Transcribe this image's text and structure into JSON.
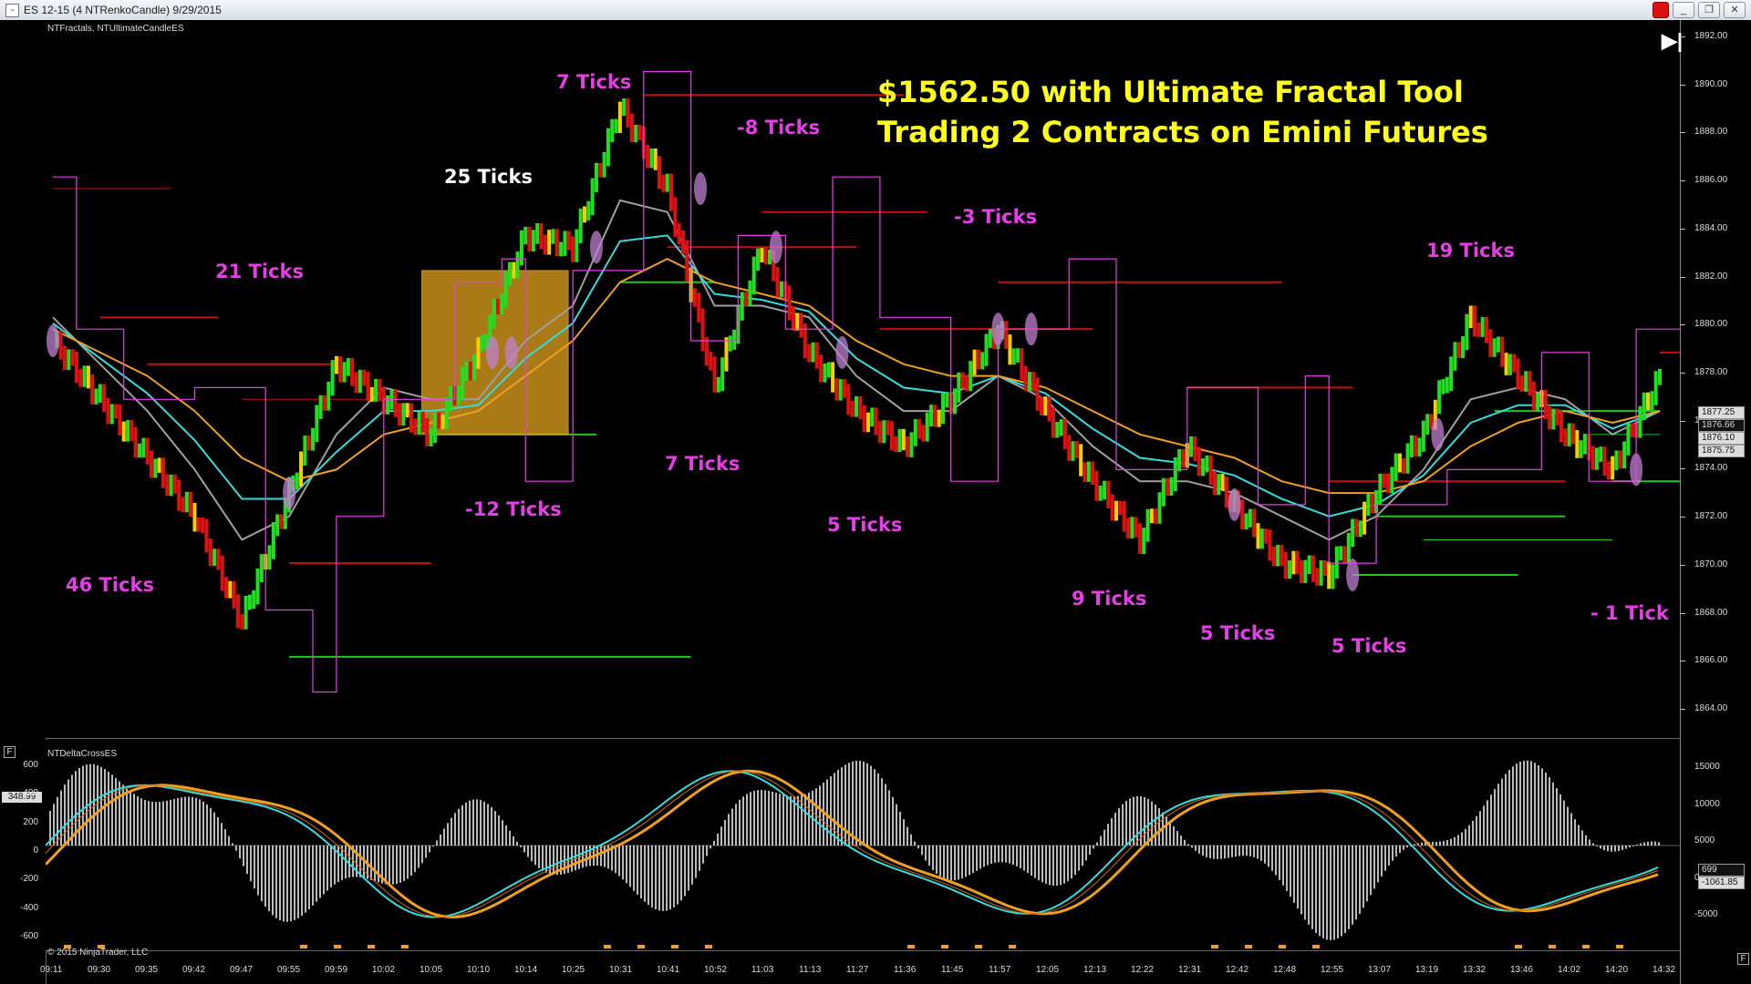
{
  "window": {
    "title": "ES 12-15 (4 NTRenkoCandle)  9/29/2015",
    "min_label": "_",
    "restore_label": "❐",
    "close_label": "✕"
  },
  "price_panel": {
    "indicators_label": "NTFractals, NTUltimateCandleES",
    "y_ticks": [
      "1892.00",
      "1890.00",
      "1888.00",
      "1886.00",
      "1884.00",
      "1882.00",
      "1880.00",
      "1878.00",
      "1876.00",
      "1874.00",
      "1872.00",
      "1870.00",
      "1868.00",
      "1866.00",
      "1864.00"
    ],
    "price_tags": [
      "1877.25",
      "1876.66",
      "1876.10",
      "1875.75"
    ]
  },
  "headline": {
    "line1": "$1562.50 with Ultimate Fractal Tool",
    "line2": "Trading 2 Contracts on Emini Futures"
  },
  "annotations": [
    {
      "text": "7 Ticks",
      "color": "magenta"
    },
    {
      "text": "-8 Ticks",
      "color": "magenta"
    },
    {
      "text": "25 Ticks",
      "color": "white"
    },
    {
      "text": "-3 Ticks",
      "color": "magenta"
    },
    {
      "text": "21 Ticks",
      "color": "magenta"
    },
    {
      "text": "19 Ticks",
      "color": "magenta"
    },
    {
      "text": "7 Ticks",
      "color": "magenta"
    },
    {
      "text": "-12 Ticks",
      "color": "magenta"
    },
    {
      "text": "5 Ticks",
      "color": "magenta"
    },
    {
      "text": "46 Ticks",
      "color": "magenta"
    },
    {
      "text": "9 Ticks",
      "color": "magenta"
    },
    {
      "text": "5 Ticks",
      "color": "magenta"
    },
    {
      "text": "5 Ticks",
      "color": "magenta"
    },
    {
      "text": "- 1 Tick",
      "color": "magenta"
    }
  ],
  "indicator_panel": {
    "label": "NTDeltaCrossES",
    "left_ticks": [
      "600",
      "400",
      "200",
      "0",
      "-200",
      "-400",
      "-600"
    ],
    "right_ticks": [
      "15000",
      "10000",
      "5000",
      "0",
      "-5000"
    ],
    "left_value": "348.99",
    "right_tags": [
      "699",
      "-1061.85"
    ],
    "f_label": "F"
  },
  "x_ticks": [
    "09:11",
    "09:30",
    "09:35",
    "09:42",
    "09:47",
    "09:55",
    "09:59",
    "10:02",
    "10:05",
    "10:10",
    "10:14",
    "10:25",
    "10:31",
    "10:41",
    "10:52",
    "11:03",
    "11:13",
    "11:27",
    "11:36",
    "11:45",
    "11:57",
    "12:05",
    "12:13",
    "12:22",
    "12:31",
    "12:42",
    "12:48",
    "12:55",
    "13:07",
    "13:19",
    "13:32",
    "13:46",
    "14:02",
    "14:20",
    "14:32"
  ],
  "copyright": "© 2015 NinjaTrader, LLC",
  "colors": {
    "up": "#22dd22",
    "down": "#dd1111",
    "neutral": "#f5d000",
    "magenta": "#e63ee6",
    "cyan": "#33dddd",
    "orange": "#f0a020",
    "gray_ma": "#a0a0a0"
  },
  "chart_data": {
    "type": "line",
    "title": "",
    "x": [
      "09:11",
      "09:30",
      "09:35",
      "09:42",
      "09:47",
      "09:55",
      "09:59",
      "10:02",
      "10:05",
      "10:10",
      "10:14",
      "10:25",
      "10:31",
      "10:41",
      "10:52",
      "11:03",
      "11:13",
      "11:27",
      "11:36",
      "11:45",
      "11:57",
      "12:05",
      "12:13",
      "12:22",
      "12:31",
      "12:42",
      "12:48",
      "12:55",
      "13:07",
      "13:19",
      "13:32",
      "13:46",
      "14:02",
      "14:20",
      "14:32"
    ],
    "series": [
      {
        "values": [
          1879.5,
          1877.0,
          1874.5,
          1872.0,
          1867.5,
          1873.0,
          1878.5,
          1877.0,
          1875.5,
          1879.0,
          1884.0,
          1883.5,
          1889.5,
          1886.0,
          1877.5,
          1883.5,
          1879.0,
          1876.5,
          1875.0,
          1877.0,
          1880.0,
          1876.5,
          1873.5,
          1871.0,
          1875.0,
          1872.5,
          1870.0,
          1869.5,
          1873.0,
          1875.5,
          1880.5,
          1878.0,
          1875.5,
          1874.0,
          1878.0
        ]
      },
      {
        "values": [
          1880.5,
          1878.5,
          1876.5,
          1874.0,
          1871.0,
          1872.0,
          1875.5,
          1877.5,
          1877.0,
          1877.0,
          1879.5,
          1881.0,
          1885.5,
          1885.0,
          1881.0,
          1881.0,
          1880.5,
          1878.0,
          1876.5,
          1876.5,
          1878.0,
          1877.0,
          1875.0,
          1873.5,
          1873.5,
          1873.0,
          1872.0,
          1871.0,
          1872.0,
          1874.0,
          1877.0,
          1877.5,
          1877.0,
          1875.5,
          1876.5
        ]
      },
      {
        "values": [
          1880.0,
          1879.0,
          1878.0,
          1876.5,
          1874.5,
          1873.5,
          1874.0,
          1875.5,
          1876.0,
          1876.5,
          1878.0,
          1879.5,
          1882.0,
          1883.0,
          1882.0,
          1881.5,
          1881.0,
          1879.5,
          1878.5,
          1878.0,
          1878.0,
          1877.5,
          1876.5,
          1875.5,
          1875.0,
          1874.5,
          1873.5,
          1873.0,
          1873.0,
          1873.5,
          1875.0,
          1876.0,
          1876.5,
          1876.0,
          1876.5
        ]
      }
    ],
    "ylim": [
      1863.0,
      1892.5
    ],
    "grid": false
  }
}
